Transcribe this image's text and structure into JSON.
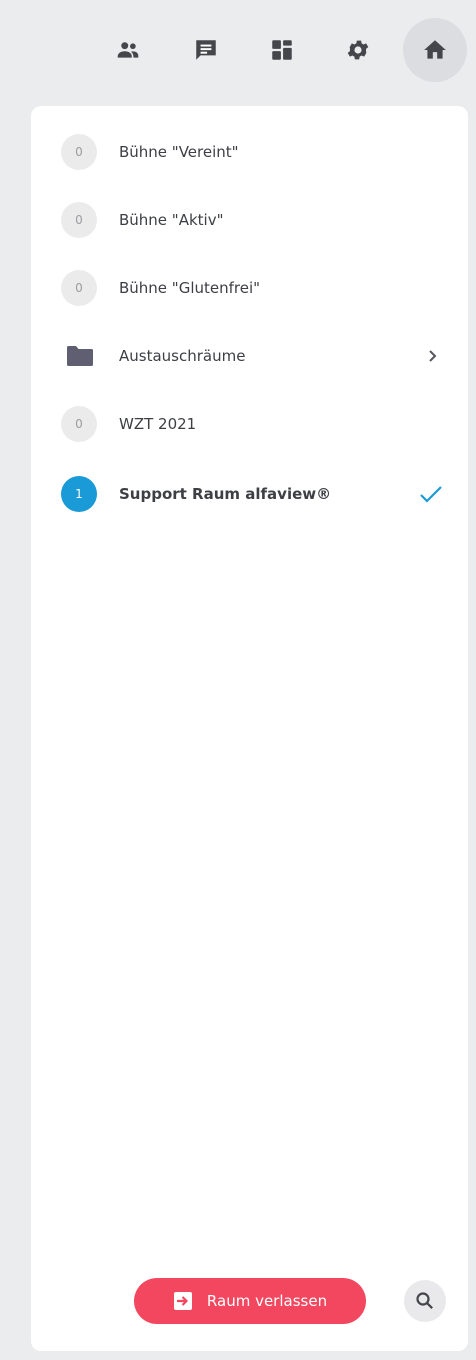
{
  "toolbar": {
    "buttons": [
      {
        "icon": "users-icon"
      },
      {
        "icon": "chat-icon"
      },
      {
        "icon": "dashboard-icon"
      },
      {
        "icon": "gear-icon"
      },
      {
        "icon": "home-icon",
        "active": true
      }
    ]
  },
  "rooms": [
    {
      "count": "0",
      "label": "Bühne \"Vereint\""
    },
    {
      "count": "0",
      "label": "Bühne \"Aktiv\""
    },
    {
      "count": "0",
      "label": "Bühne \"Glutenfrei\""
    },
    {
      "type": "folder",
      "label": "Austauschräume",
      "icon": "folder-icon"
    },
    {
      "count": "0",
      "label": "WZT 2021"
    },
    {
      "count": "1",
      "label": "Support Raum alfaview®",
      "active": true
    }
  ],
  "footer": {
    "leave_label": "Raum verlassen",
    "leave_icon": "exit-icon",
    "search_icon": "search-icon"
  },
  "colors": {
    "accent": "#1a9ad6",
    "danger": "#f2475e",
    "background": "#ebecee",
    "panel": "#ffffff"
  }
}
